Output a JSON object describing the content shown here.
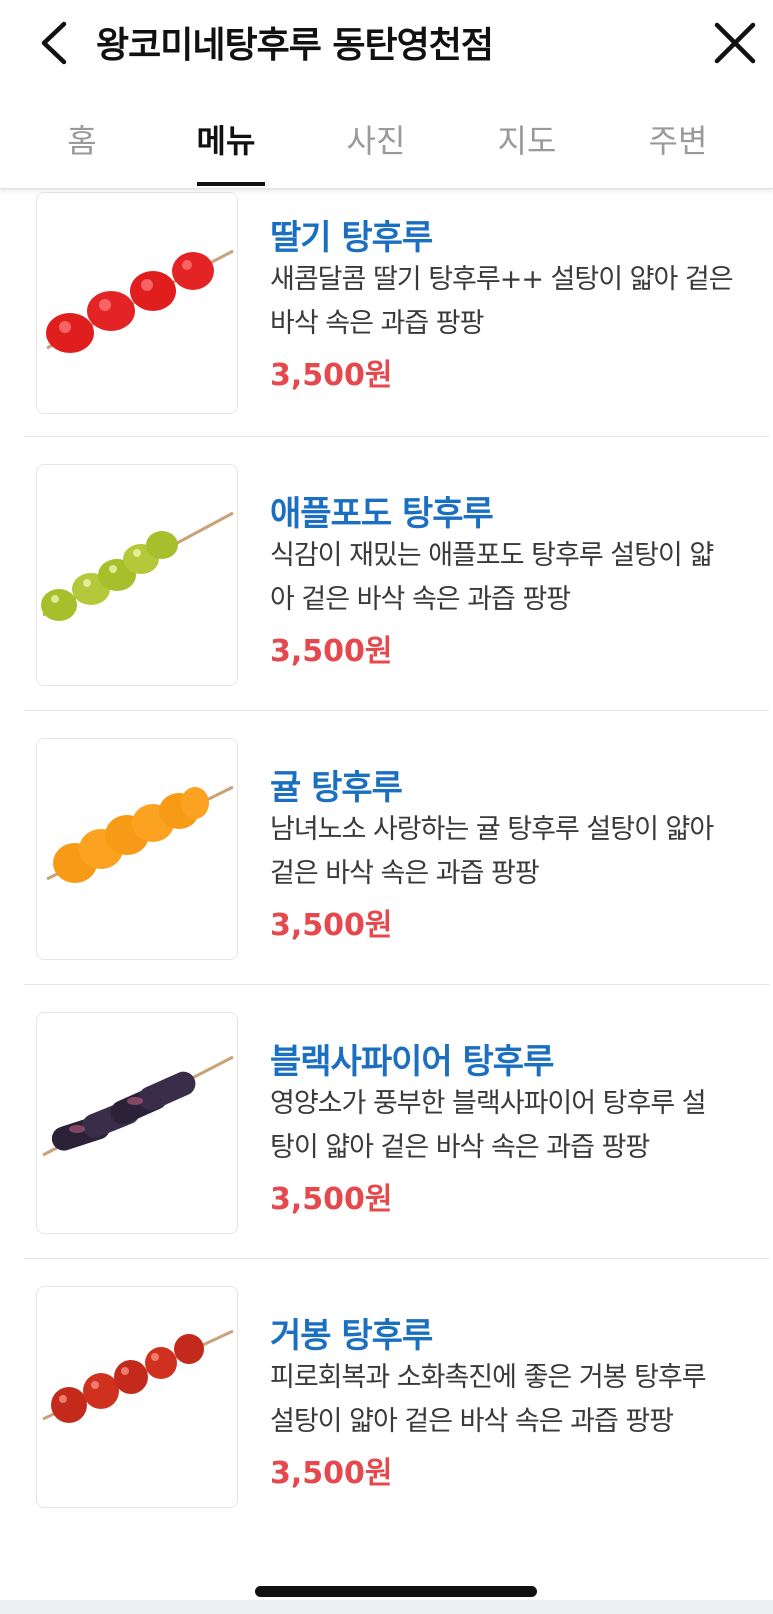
{
  "header": {
    "title": "왕코미네탕후루 동탄영천점"
  },
  "tabs": [
    {
      "label": "홈",
      "active": false
    },
    {
      "label": "메뉴",
      "active": true
    },
    {
      "label": "사진",
      "active": false
    },
    {
      "label": "지도",
      "active": false
    },
    {
      "label": "주변",
      "active": false
    }
  ],
  "menu": [
    {
      "name": "딸기 탕후루",
      "desc_lines": [
        "새콤달콤 딸기 탕후루++ 설탕이 얇아 겉은",
        "바삭 속은 과즙 팡팡"
      ],
      "price": "3,500원",
      "fruit": "strawberry"
    },
    {
      "name": "애플포도 탕후루",
      "desc_lines": [
        "식감이 재밌는 애플포도 탕후루 설탕이 얇",
        "아 겉은 바삭 속은 과즙 팡팡"
      ],
      "price": "3,500원",
      "fruit": "green-grape"
    },
    {
      "name": "귤 탕후루",
      "desc_lines": [
        "남녀노소 사랑하는 귤 탕후루 설탕이 얇아",
        "겉은 바삭 속은 과즙 팡팡"
      ],
      "price": "3,500원",
      "fruit": "tangerine"
    },
    {
      "name": "블랙사파이어 탕후루",
      "desc_lines": [
        "영양소가 풍부한 블랙사파이어 탕후루 설",
        "탕이 얇아 겉은 바삭 속은 과즙 팡팡"
      ],
      "price": "3,500원",
      "fruit": "black-sapphire-grape"
    },
    {
      "name": "거봉 탕후루",
      "desc_lines": [
        "피로회복과 소화촉진에 좋은 거봉 탕후루",
        "설탕이 얇아 겉은 바삭 속은 과즙 팡팡"
      ],
      "price": "3,500원",
      "fruit": "red-grape"
    }
  ],
  "colors": {
    "item_name": "#1a6fc0",
    "price": "#e5484d",
    "tab_active": "#111111",
    "tab_inactive": "#9a9a9a"
  },
  "icons": {
    "back": "chevron-left-icon",
    "close": "close-icon"
  }
}
